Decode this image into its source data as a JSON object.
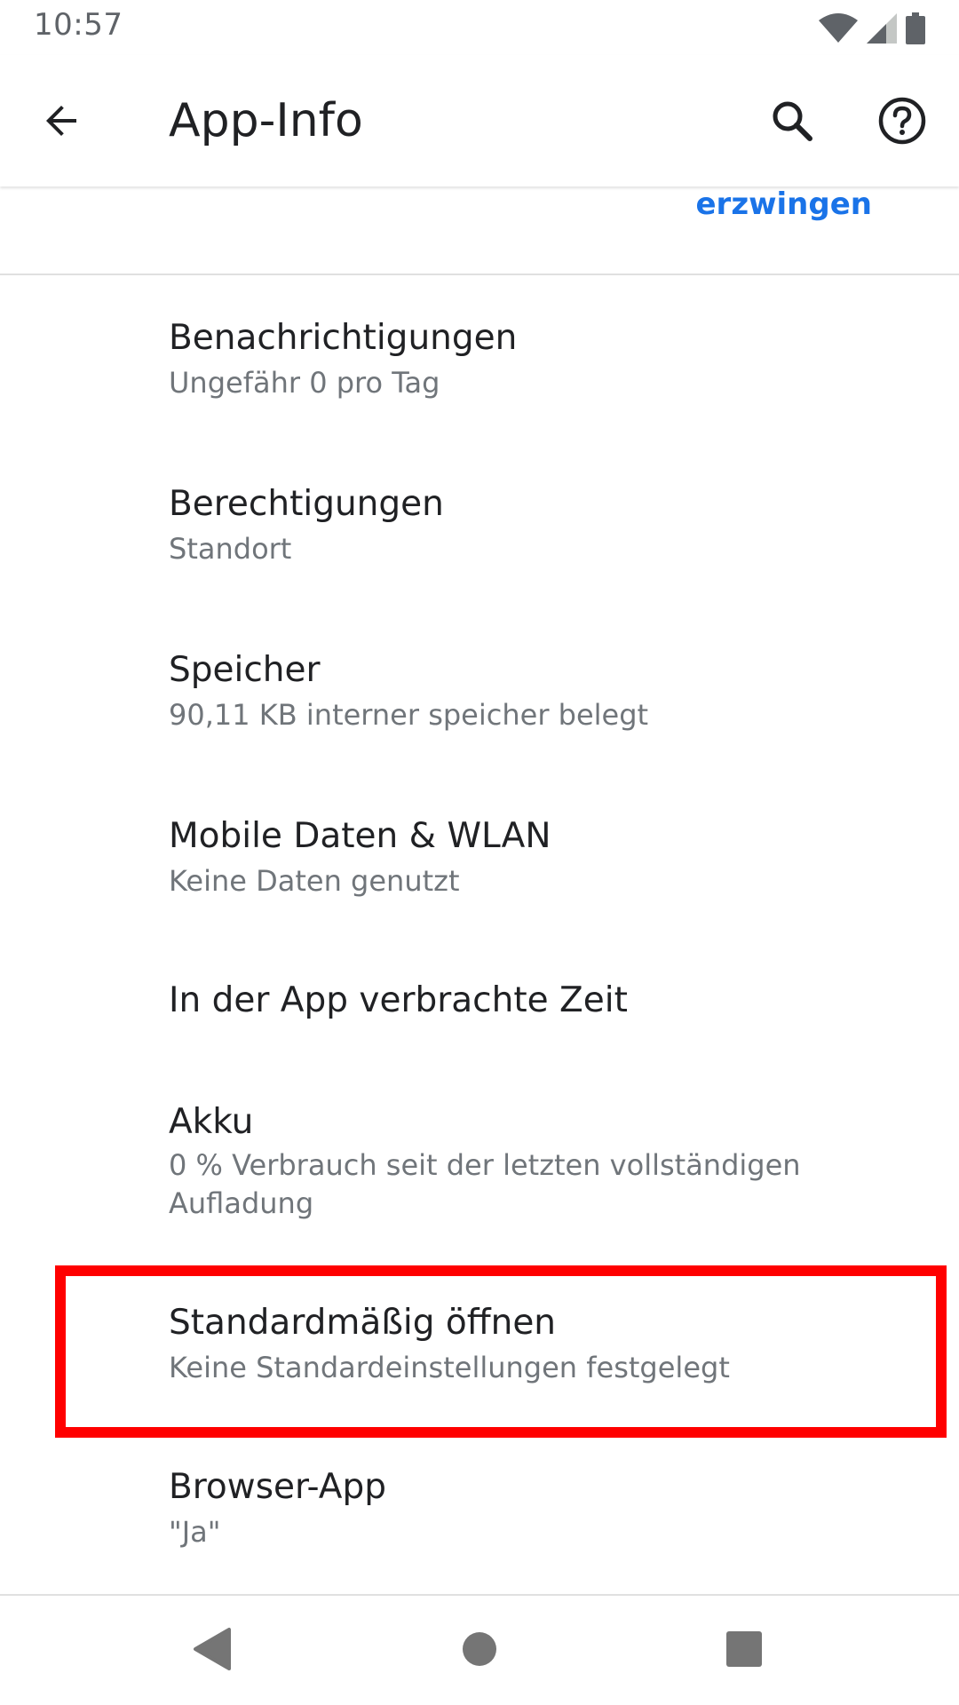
{
  "status_bar": {
    "time": "10:57",
    "icons": [
      "wifi-icon",
      "signal-icon",
      "battery-icon"
    ]
  },
  "app_bar": {
    "title": "App-Info",
    "back_icon": "arrow-back-icon",
    "search_icon": "search-icon",
    "help_icon": "help-icon"
  },
  "force_stop": {
    "label": "erzwingen"
  },
  "list": {
    "items": [
      {
        "title": "Benachrichtigungen",
        "subtitle": "Ungefähr 0 pro Tag"
      },
      {
        "title": "Berechtigungen",
        "subtitle": "Standort"
      },
      {
        "title": "Speicher",
        "subtitle": "90,11 KB interner speicher belegt"
      },
      {
        "title": "Mobile Daten & WLAN",
        "subtitle": "Keine Daten genutzt"
      },
      {
        "title": "In der App verbrachte Zeit",
        "subtitle": ""
      },
      {
        "title": "Akku",
        "subtitle": "0 % Verbrauch seit der letzten vollständigen Aufladung"
      },
      {
        "title": "Standardmäßig öffnen",
        "subtitle": "Keine Standardeinstellungen festgelegt"
      },
      {
        "title": "Browser-App",
        "subtitle": "\"Ja\""
      }
    ]
  },
  "colors": {
    "accent": "#1a73e8",
    "highlight": "#ff0000",
    "text_primary": "#202124",
    "text_secondary": "#70757a"
  },
  "nav_bar": {
    "icons": [
      "back-triangle-icon",
      "home-circle-icon",
      "recents-square-icon"
    ]
  }
}
